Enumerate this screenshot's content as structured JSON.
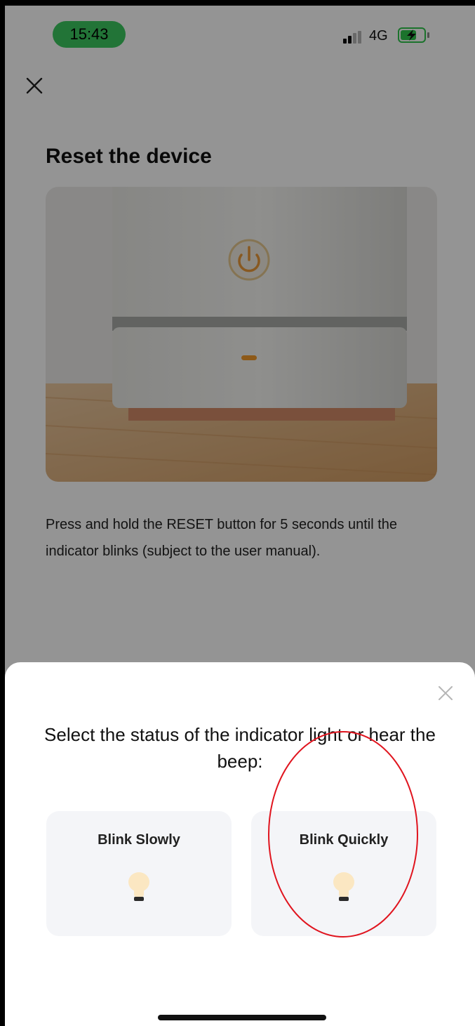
{
  "status_bar": {
    "time": "15:43",
    "network": "4G",
    "signal_icon": "signal-icon",
    "battery_icon": "battery-charging-icon",
    "battery_color": "#2fc64d",
    "time_pill_color": "#3cc95f"
  },
  "page": {
    "close_icon": "close-icon",
    "title": "Reset the device",
    "hero_image": "device-reset-photo",
    "description": "Press and hold the RESET button for 5 seconds until the indicator blinks (subject to the user manual)."
  },
  "sheet": {
    "close_icon": "close-icon",
    "title": "Select the status of the indicator light or hear the beep:",
    "options": [
      {
        "label": "Blink Slowly",
        "icon": "light-bulb-icon"
      },
      {
        "label": "Blink Quickly",
        "icon": "light-bulb-icon"
      }
    ],
    "highlight_color": "#e0141e"
  }
}
